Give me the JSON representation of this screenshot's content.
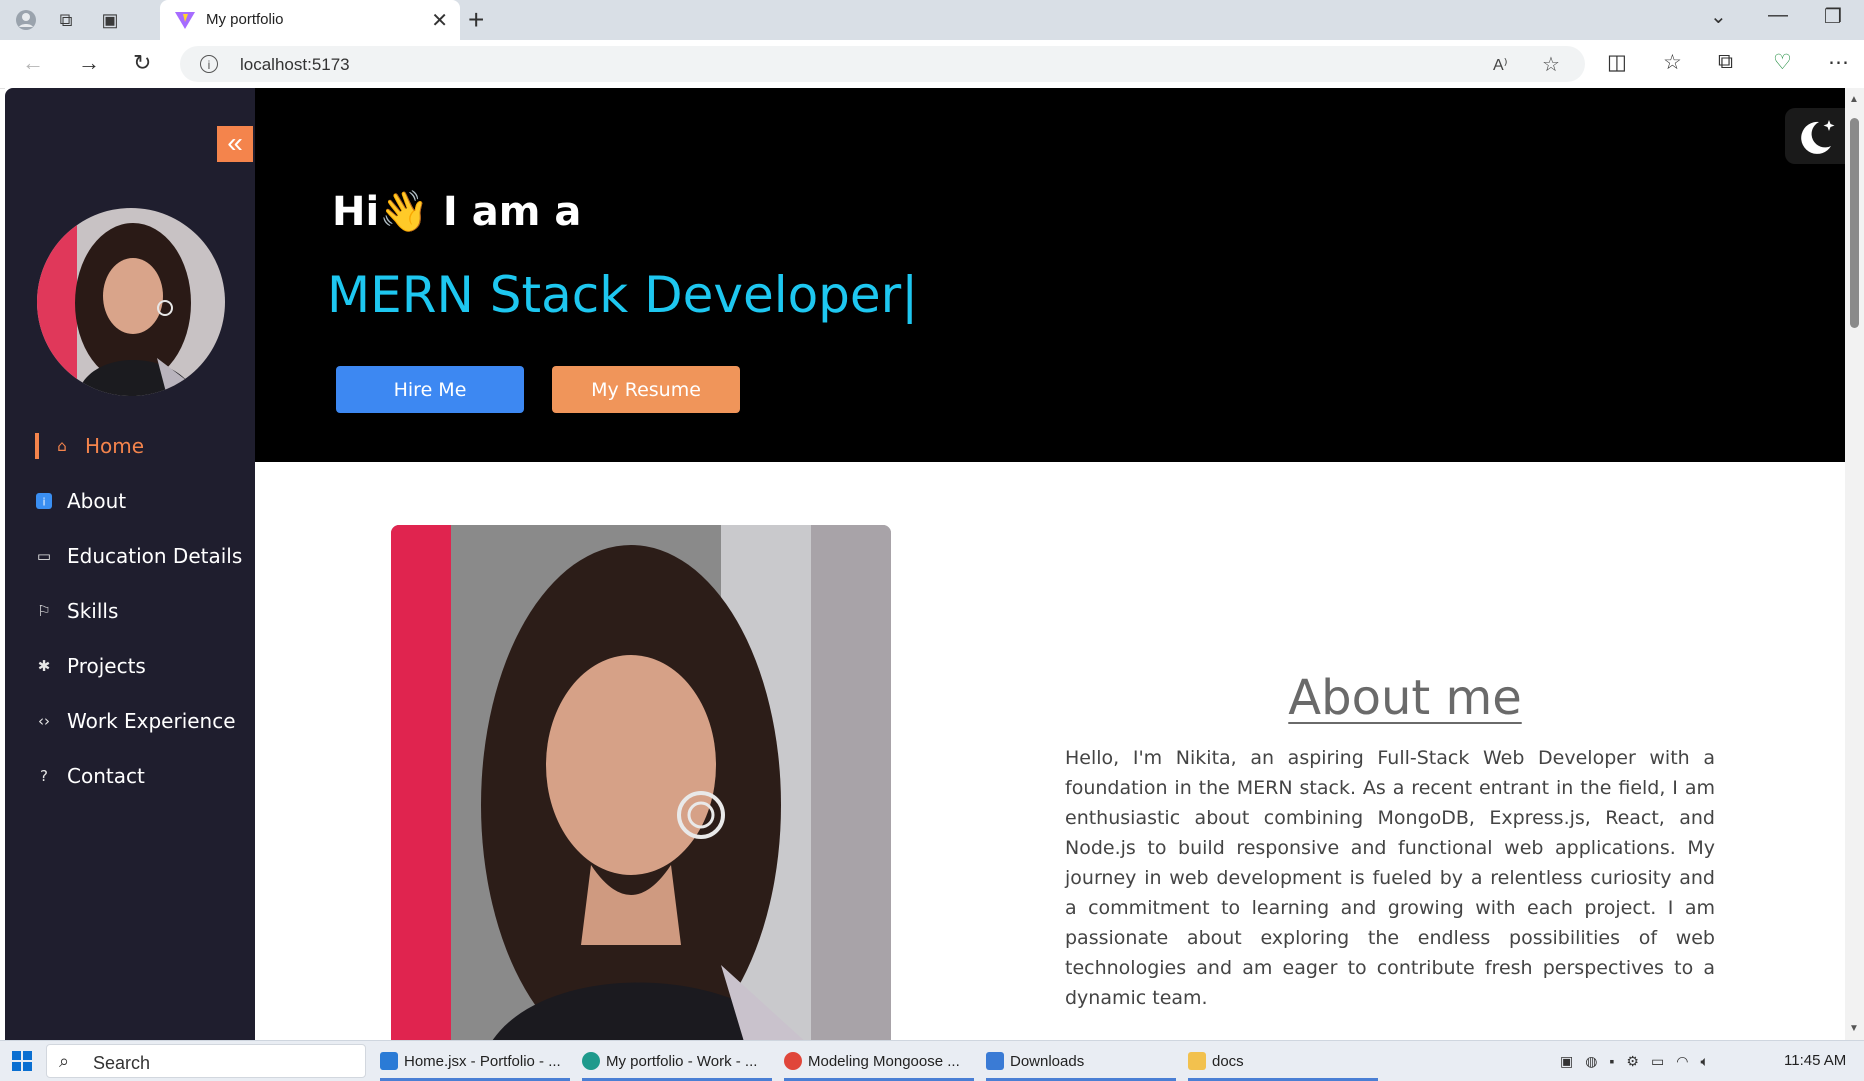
{
  "browser": {
    "tab_title": "My portfolio",
    "url": "localhost:5173"
  },
  "sidebar": {
    "nav": [
      {
        "label": "Home",
        "icon": "home-icon",
        "active": true
      },
      {
        "label": "About",
        "icon": "info-icon"
      },
      {
        "label": "Education Details",
        "icon": "cast-icon"
      },
      {
        "label": "Skills",
        "icon": "skills-icon"
      },
      {
        "label": "Projects",
        "icon": "projects-icon"
      },
      {
        "label": "Work Experience",
        "icon": "code-icon"
      },
      {
        "label": "Contact",
        "icon": "help-circle-icon"
      }
    ]
  },
  "hero": {
    "greeting": "Hi👋 I am a",
    "role": "MERN Stack Developer|",
    "hire_label": "Hire Me",
    "resume_label": "My Resume"
  },
  "about": {
    "title": "About me",
    "text": "Hello, I'm Nikita, an aspiring Full-Stack Web Developer with a foundation in the MERN stack. As a recent entrant in the field, I am enthusiastic about combining MongoDB, Express.js, React, and Node.js to build responsive and functional web applications. My journey in web development is fueled by a relentless curiosity and a commitment to learning and growing with each project. I am passionate about exploring the endless possibilities of web technologies and am eager to contribute fresh perspectives to a dynamic team."
  },
  "taskbar": {
    "search_label": "Search",
    "tasks": [
      {
        "label": "Home.jsx - Portfolio - ...",
        "color": "#2b7bd6"
      },
      {
        "label": "My portfolio - Work - ...",
        "color": "#1f9a8c"
      },
      {
        "label": "Modeling Mongoose ...",
        "color": "#e0463a"
      },
      {
        "label": "Downloads",
        "color": "#3a7bd5"
      },
      {
        "label": "docs",
        "color": "#f2c14e"
      }
    ],
    "clock": "11:45 AM"
  },
  "colors": {
    "accent_orange": "#f4844c",
    "role_cyan": "#1ec7f0",
    "hire_blue": "#3d88f2",
    "sidebar_bg": "#1f1e2e"
  }
}
